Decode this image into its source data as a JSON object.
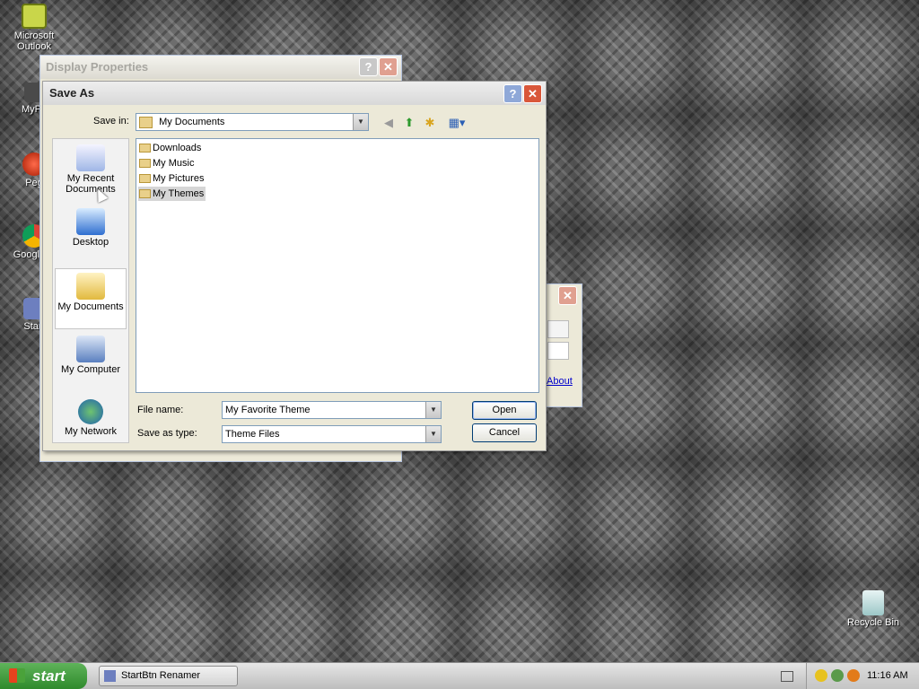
{
  "desktop": {
    "icons": [
      {
        "label": "Microsoft Outlook"
      },
      {
        "label": "MyPa"
      },
      {
        "label": "Peg"
      },
      {
        "label": "Google C"
      },
      {
        "label": "Start"
      },
      {
        "label": "Recycle Bin"
      }
    ]
  },
  "display_properties": {
    "title": "Display Properties"
  },
  "background_window": {
    "link": "About"
  },
  "save_as": {
    "title": "Save As",
    "save_in_label": "Save in:",
    "save_in_value": "My Documents",
    "places": [
      {
        "label": "My Recent Documents"
      },
      {
        "label": "Desktop"
      },
      {
        "label": "My Documents"
      },
      {
        "label": "My Computer"
      },
      {
        "label": "My Network"
      }
    ],
    "files": [
      {
        "name": "Downloads"
      },
      {
        "name": "My Music"
      },
      {
        "name": "My Pictures"
      },
      {
        "name": "My Themes"
      }
    ],
    "file_name_label": "File name:",
    "file_name_value": "My Favorite Theme",
    "type_label": "Save as type:",
    "type_value": "Theme Files",
    "open_button": "Open",
    "cancel_button": "Cancel"
  },
  "taskbar": {
    "start_label": "start",
    "task_label": "StartBtn Renamer",
    "clock": "11:16 AM"
  }
}
